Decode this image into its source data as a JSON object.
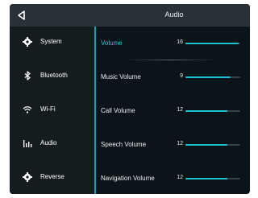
{
  "header": {
    "title": "Audio",
    "back_icon": "back-arrow-icon"
  },
  "sidebar": {
    "items": [
      {
        "label": "System",
        "icon": "gear-icon"
      },
      {
        "label": "Bluetooth",
        "icon": "bluetooth-icon"
      },
      {
        "label": "Wi-Fi",
        "icon": "wifi-icon"
      },
      {
        "label": "Audio",
        "icon": "equalizer-icon"
      },
      {
        "label": "Reverse",
        "icon": "gear-icon"
      }
    ]
  },
  "volumes": {
    "max": 30,
    "items": [
      {
        "label": "Volume",
        "value": "16",
        "active": true
      },
      {
        "label": "Music Volume",
        "value": "9",
        "active": false
      },
      {
        "label": "Call Volume",
        "value": "12",
        "active": false
      },
      {
        "label": "Speech Volume",
        "value": "12",
        "active": false
      },
      {
        "label": "Navigation Volume",
        "value": "12",
        "active": false
      }
    ],
    "slider_fill_fraction": [
      0.97,
      0.82,
      0.77,
      0.77,
      0.77
    ]
  },
  "colors": {
    "accent": "#1fc0d2",
    "background": "#0b1418",
    "sidebar": "#151c20",
    "topbar": "#2a3136"
  }
}
